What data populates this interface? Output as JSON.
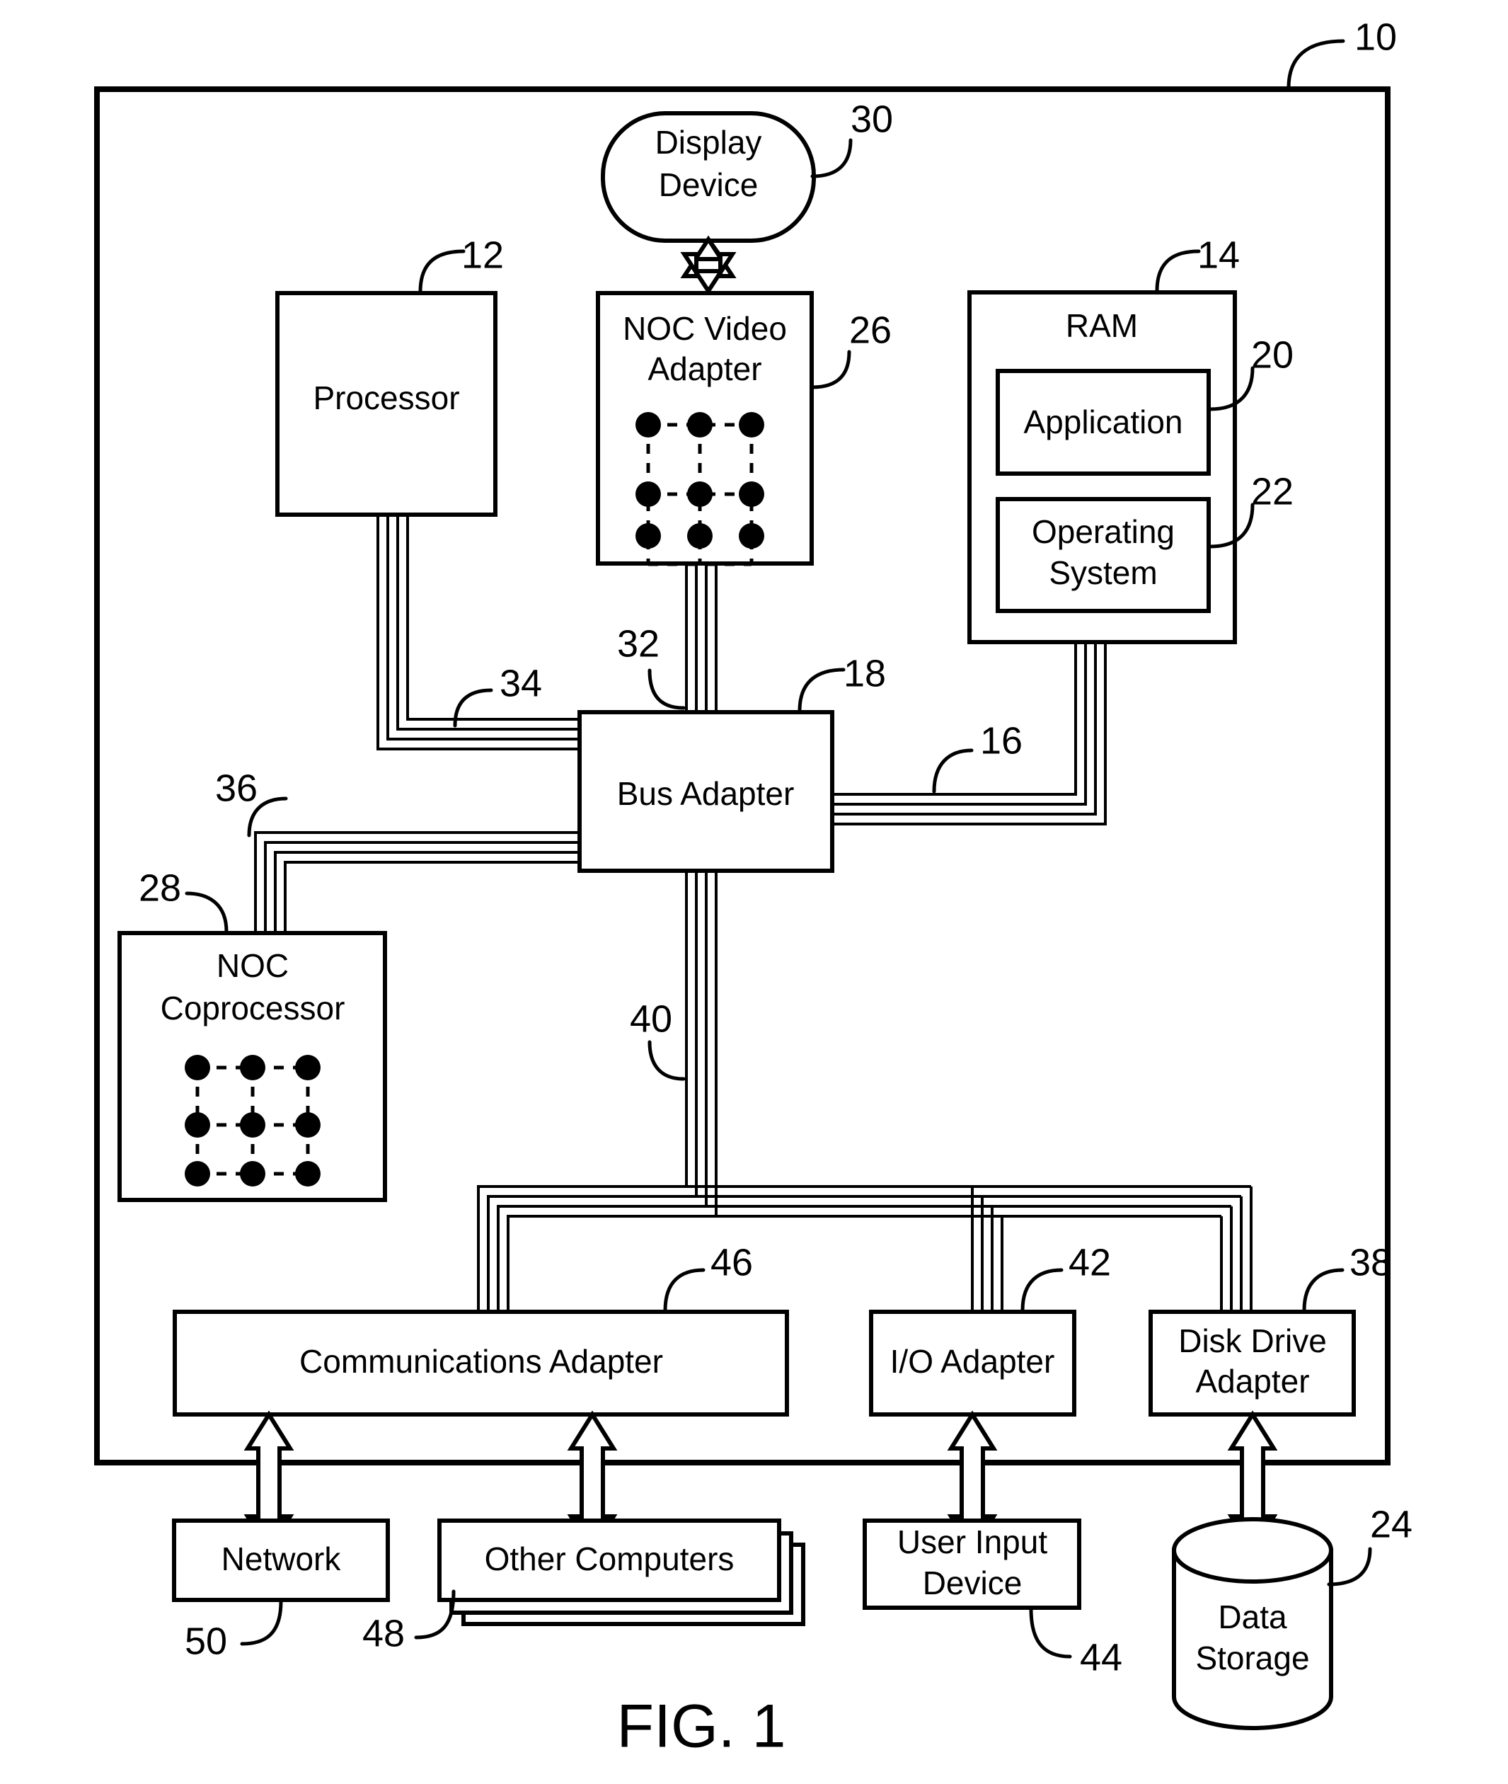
{
  "figure": {
    "caption": "FIG. 1",
    "system_ref": "10"
  },
  "blocks": {
    "display_device": {
      "line1": "Display",
      "line2": "Device",
      "ref": "30"
    },
    "processor": {
      "line1": "Processor",
      "ref": "12"
    },
    "noc_video": {
      "line1": "NOC Video",
      "line2": "Adapter",
      "ref": "26"
    },
    "ram": {
      "line1": "RAM",
      "ref": "14"
    },
    "application": {
      "line1": "Application",
      "ref": "20"
    },
    "operating_system": {
      "line1": "Operating",
      "line2": "System",
      "ref": "22"
    },
    "bus_adapter": {
      "line1": "Bus Adapter",
      "ref": "18"
    },
    "noc_coprocessor": {
      "line1": "NOC",
      "line2": "Coprocessor",
      "ref": "28"
    },
    "comm_adapter": {
      "line1": "Communications Adapter",
      "ref": "46"
    },
    "io_adapter": {
      "line1": "I/O Adapter",
      "ref": "42"
    },
    "disk_adapter": {
      "line1": "Disk Drive",
      "line2": "Adapter",
      "ref": "38"
    },
    "network": {
      "line1": "Network",
      "ref": "50"
    },
    "other_computers": {
      "line1": "Other Computers",
      "ref": "48"
    },
    "user_input": {
      "line1": "User Input",
      "line2": "Device",
      "ref": "44"
    },
    "data_storage": {
      "line1": "Data",
      "line2": "Storage",
      "ref": "24"
    }
  },
  "bus_refs": {
    "memory_bus": "16",
    "front_side_bus": "18",
    "video_bus": "32",
    "processor_bus": "34",
    "coprocessor_bus": "36",
    "expansion_bus": "40"
  },
  "colors": {
    "line": "#000000",
    "fill": "#ffffff",
    "background": "#ffffff"
  }
}
